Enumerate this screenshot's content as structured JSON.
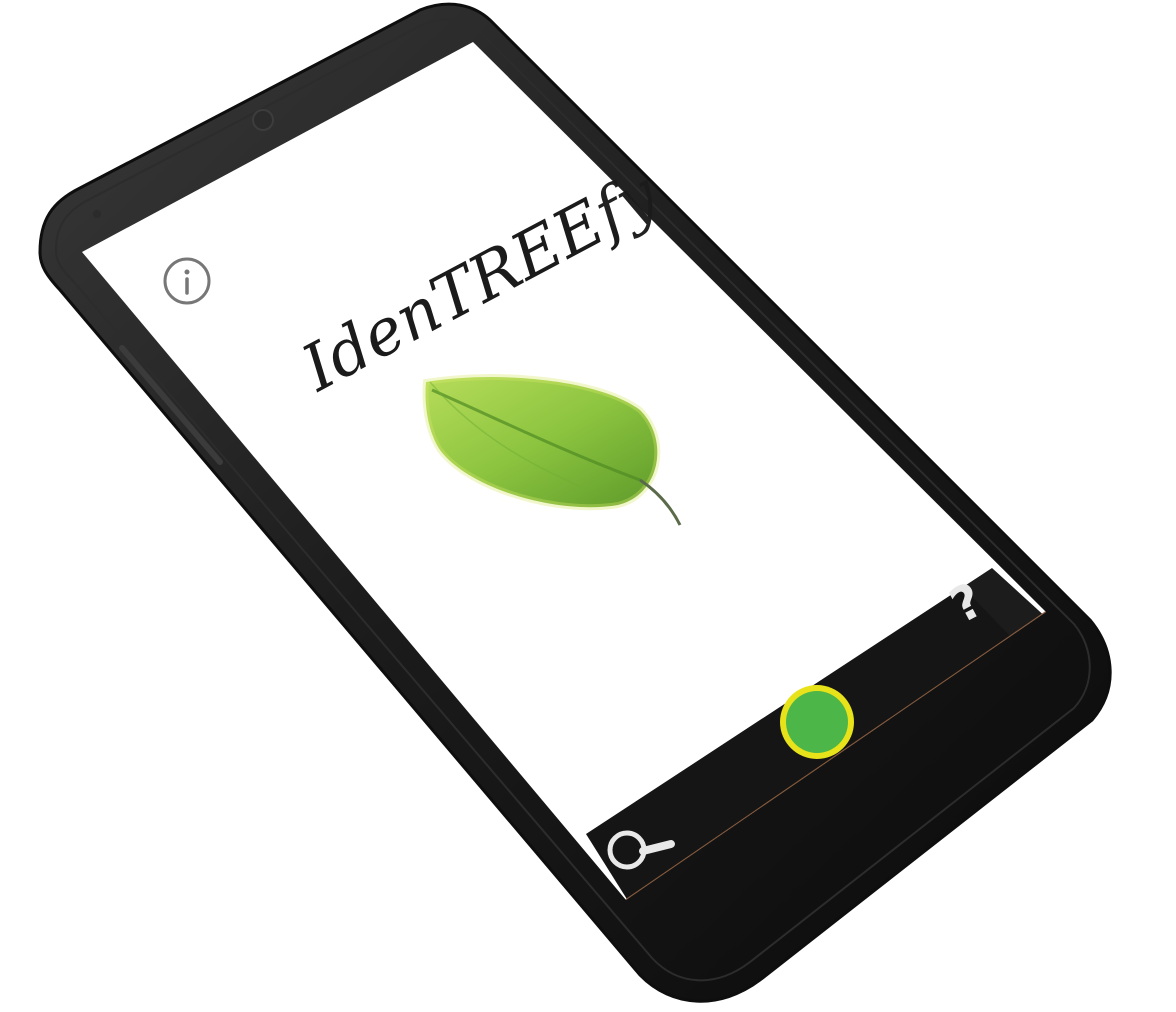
{
  "app": {
    "title": "IdenTREEfy"
  },
  "screen": {
    "info_icon": "info-icon",
    "logo_icon": "leaf-icon"
  },
  "bottom_bar": {
    "search_icon": "search-icon",
    "capture_icon": "capture-button",
    "help_label": "?"
  },
  "colors": {
    "device_body": "#1a1a1a",
    "screen_bg": "#ffffff",
    "bar_bg": "#141414",
    "capture_fill": "#4cb648",
    "capture_ring": "#e8e21a",
    "leaf_light": "#9fd04a",
    "leaf_dark": "#5f9a2c"
  }
}
